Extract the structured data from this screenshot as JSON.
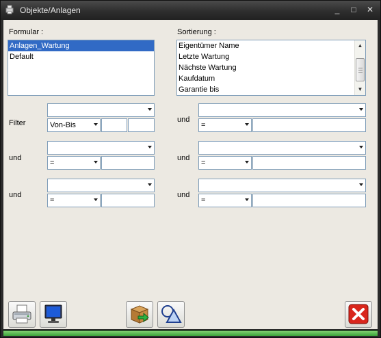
{
  "window": {
    "title": "Objekte/Anlagen",
    "controls": {
      "minimize": "_",
      "maximize": "□",
      "close": "✕"
    },
    "status_color": "#3aa33a"
  },
  "formular": {
    "label": "Formular :",
    "items": [
      "Anlagen_Wartung",
      "Default"
    ],
    "selected": "Anlagen_Wartung"
  },
  "sortierung": {
    "label": "Sortierung :",
    "items": [
      "Eigentümer Name",
      "Letzte Wartung",
      "Nächste Wartung",
      "Kaufdatum",
      "Garantie bis"
    ]
  },
  "filter": {
    "left": [
      {
        "label": "Filter",
        "field": "",
        "operator": "Von-Bis",
        "value_from": "",
        "value_to": ""
      },
      {
        "label": "und",
        "field": "",
        "operator": "=",
        "value": ""
      },
      {
        "label": "und",
        "field": "",
        "operator": "=",
        "value": ""
      }
    ],
    "right": [
      {
        "label": "und",
        "field": "",
        "operator": "=",
        "value": ""
      },
      {
        "label": "und",
        "field": "",
        "operator": "=",
        "value": ""
      },
      {
        "label": "und",
        "field": "",
        "operator": "=",
        "value": ""
      }
    ]
  },
  "toolbar": {
    "icons": [
      "printer-icon",
      "monitor-icon",
      "export-package-icon",
      "shapes-icon",
      "close-red-icon"
    ]
  }
}
